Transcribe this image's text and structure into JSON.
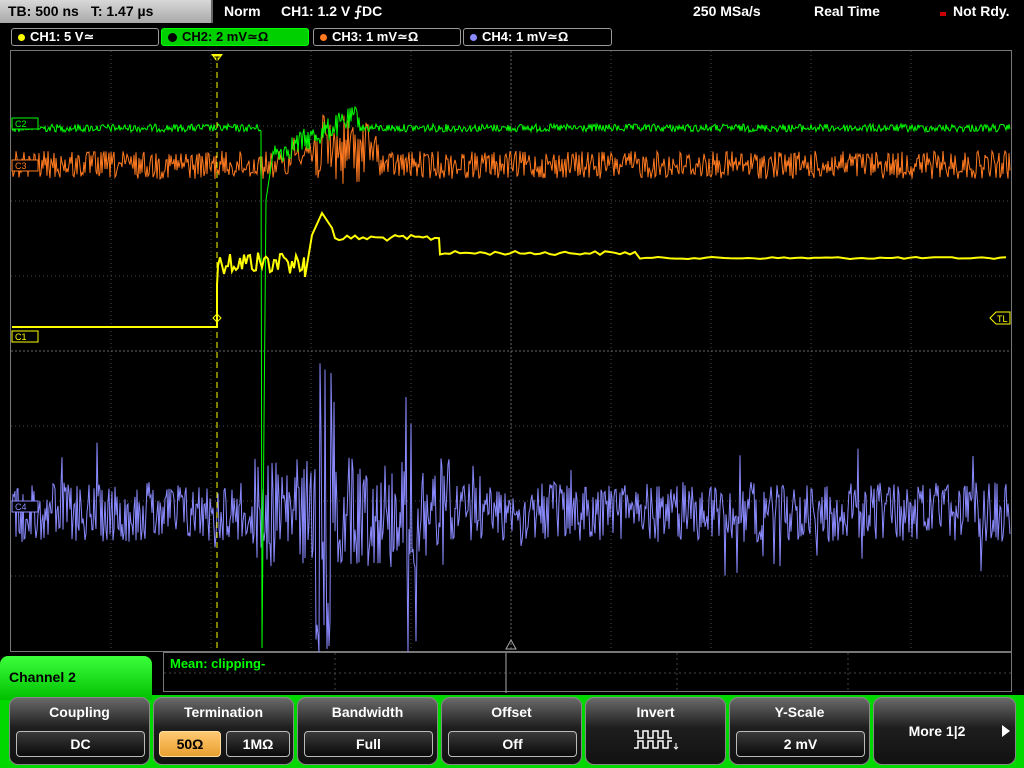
{
  "status": {
    "timebase": "TB: 500 ns",
    "trigger_time": "T: 1.47 µs",
    "trigger_mode": "Norm",
    "trigger_source": "CH1: 1.2 V ⨍DC",
    "sample_rate": "250 MSa/s",
    "acq_mode": "Real Time",
    "trigger_state": "Not Rdy."
  },
  "channels": [
    {
      "label": "CH1: 5 V≃",
      "color": "#ffff00",
      "marker": "C1"
    },
    {
      "label": "CH2: 2 mV≃Ω",
      "color": "#00ff00",
      "marker": "C2"
    },
    {
      "label": "CH3: 1 mV≃Ω",
      "color": "#ff7a20",
      "marker": "C3"
    },
    {
      "label": "CH4: 1 mV≃Ω",
      "color": "#8a8aff",
      "marker": "C4"
    }
  ],
  "trigger_marker": "T",
  "trigger_level_marker": "TL",
  "measurement": "Mean: clipping-",
  "menu": {
    "title": "Channel 2",
    "keys": [
      {
        "title": "Coupling",
        "values": [
          "DC"
        ]
      },
      {
        "title": "Termination",
        "values": [
          "50Ω",
          "1MΩ"
        ],
        "selected": "50Ω"
      },
      {
        "title": "Bandwidth",
        "values": [
          "Full"
        ]
      },
      {
        "title": "Offset",
        "values": [
          "Off"
        ]
      },
      {
        "title": "Invert",
        "icon": "invert-waveform-icon"
      },
      {
        "title": "Y-Scale",
        "values": [
          "2 mV"
        ]
      },
      {
        "title": "More 1|2",
        "icon": "arrow-right-icon"
      }
    ]
  }
}
